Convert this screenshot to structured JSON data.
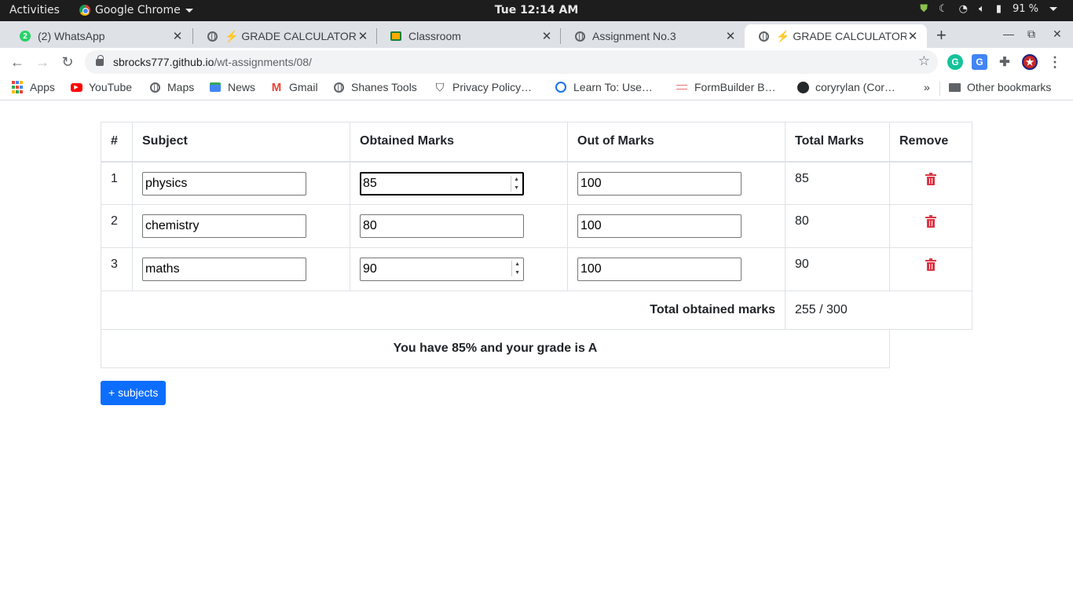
{
  "system": {
    "activities": "Activities",
    "app_name": "Google Chrome",
    "clock": "Tue 12:14 AM",
    "battery": "91 %"
  },
  "tabs": [
    {
      "title": "(2) WhatsApp",
      "badge": "2"
    },
    {
      "title": "⚡ GRADE CALCULATOR"
    },
    {
      "title": "Classroom"
    },
    {
      "title": "Assignment No.3"
    },
    {
      "title": "⚡ GRADE CALCULATOR",
      "active": true
    }
  ],
  "url": {
    "host": "sbrocks777.github.io",
    "path": "/wt-assignments/08/"
  },
  "bookmarks": [
    "Apps",
    "YouTube",
    "Maps",
    "News",
    "Gmail",
    "Shanes Tools",
    "Privacy Policy…",
    "Learn To: Use…",
    "FormBuilder B…",
    "coryrylan (Cor…"
  ],
  "bookmarks_overflow": "»",
  "other_bookmarks": "Other bookmarks",
  "table": {
    "headers": [
      "#",
      "Subject",
      "Obtained Marks",
      "Out of Marks",
      "Total Marks",
      "Remove"
    ],
    "rows": [
      {
        "index": "1",
        "subject": "physics",
        "obtained": "85",
        "out_of": "100",
        "total": "85"
      },
      {
        "index": "2",
        "subject": "chemistry",
        "obtained": "80",
        "out_of": "100",
        "total": "80"
      },
      {
        "index": "3",
        "subject": "maths",
        "obtained": "90",
        "out_of": "100",
        "total": "90"
      }
    ],
    "total_label": "Total obtained marks",
    "total_value": "255 / 300",
    "result": "You have 85% and your grade is A"
  },
  "add_button": "+ subjects",
  "colors": {
    "accent": "#0d6efd",
    "danger": "#dc3545"
  }
}
